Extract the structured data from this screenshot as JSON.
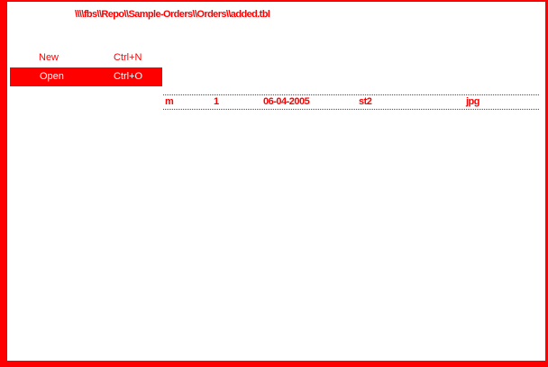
{
  "window": {
    "path": "\\\\\\\\fbs\\\\Repo\\\\Sample-Orders\\\\Orders\\\\added.tbl"
  },
  "menu": {
    "items": [
      {
        "label": "New",
        "shortcut": "Ctrl+N"
      },
      {
        "label": "Open",
        "shortcut": "Ctrl+O",
        "selected": true
      }
    ]
  },
  "file_list": {
    "rows": [
      {
        "name": "m",
        "size": "1",
        "date": "06-04-2005",
        "attr": "st2",
        "type": "jpg"
      }
    ]
  },
  "colors": {
    "accent": "#ff0000",
    "background": "#ffffff",
    "selected_text": "#ffffff"
  }
}
